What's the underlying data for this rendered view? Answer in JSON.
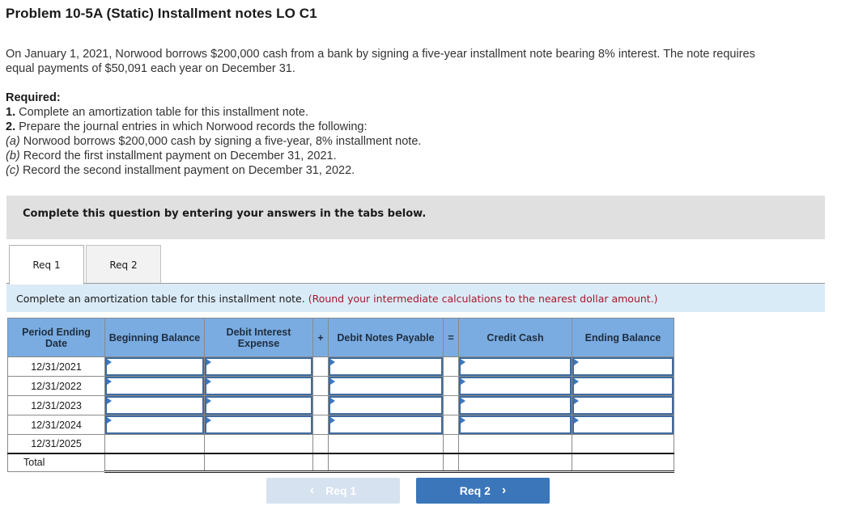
{
  "problem": {
    "title": "Problem 10-5A (Static) Installment notes LO C1",
    "intro": "On January 1, 2021, Norwood borrows $200,000 cash from a bank by signing a five-year installment note bearing 8% interest. The note requires equal payments of $50,091 each year on December 31.",
    "required_heading": "Required:",
    "required_items": [
      {
        "num": "1.",
        "text": " Complete an amortization table for this installment note."
      },
      {
        "num": "2.",
        "text": " Prepare the journal entries in which Norwood records the following:"
      },
      {
        "num": "(a)",
        "text": " Norwood borrows $200,000 cash by signing a five-year, 8% installment note."
      },
      {
        "num": "(b)",
        "text": " Record the first installment payment on December 31, 2021."
      },
      {
        "num": "(c)",
        "text": " Record the second installment payment on December 31, 2022."
      }
    ]
  },
  "instruction_banner": "Complete this question by entering your answers in the tabs below.",
  "tabs": [
    {
      "label": "Req 1",
      "active": true
    },
    {
      "label": "Req 2",
      "active": false
    }
  ],
  "sub_instruction": {
    "text": "Complete an amortization table for this installment note.",
    "note": "(Round your intermediate calculations to the nearest dollar amount.)"
  },
  "table": {
    "headers": {
      "period": "Period Ending Date",
      "beginning": "Beginning Balance",
      "interest": "Debit Interest Expense",
      "op_plus": "+",
      "notes_payable": "Debit Notes Payable",
      "op_equals": "=",
      "cash": "Credit Cash",
      "ending": "Ending Balance"
    },
    "rows": [
      {
        "date": "12/31/2021",
        "beginning": "",
        "interest": "",
        "notes_payable": "",
        "cash": "",
        "ending": ""
      },
      {
        "date": "12/31/2022",
        "beginning": "",
        "interest": "",
        "notes_payable": "",
        "cash": "",
        "ending": ""
      },
      {
        "date": "12/31/2023",
        "beginning": "",
        "interest": "",
        "notes_payable": "",
        "cash": "",
        "ending": ""
      },
      {
        "date": "12/31/2024",
        "beginning": "",
        "interest": "",
        "notes_payable": "",
        "cash": "",
        "ending": ""
      },
      {
        "date": "12/31/2025"
      }
    ],
    "total_label": "Total"
  },
  "nav": {
    "prev_label": "Req 1",
    "next_label": "Req 2",
    "prev_icon": "chevron-left-icon",
    "next_icon": "chevron-right-icon"
  }
}
